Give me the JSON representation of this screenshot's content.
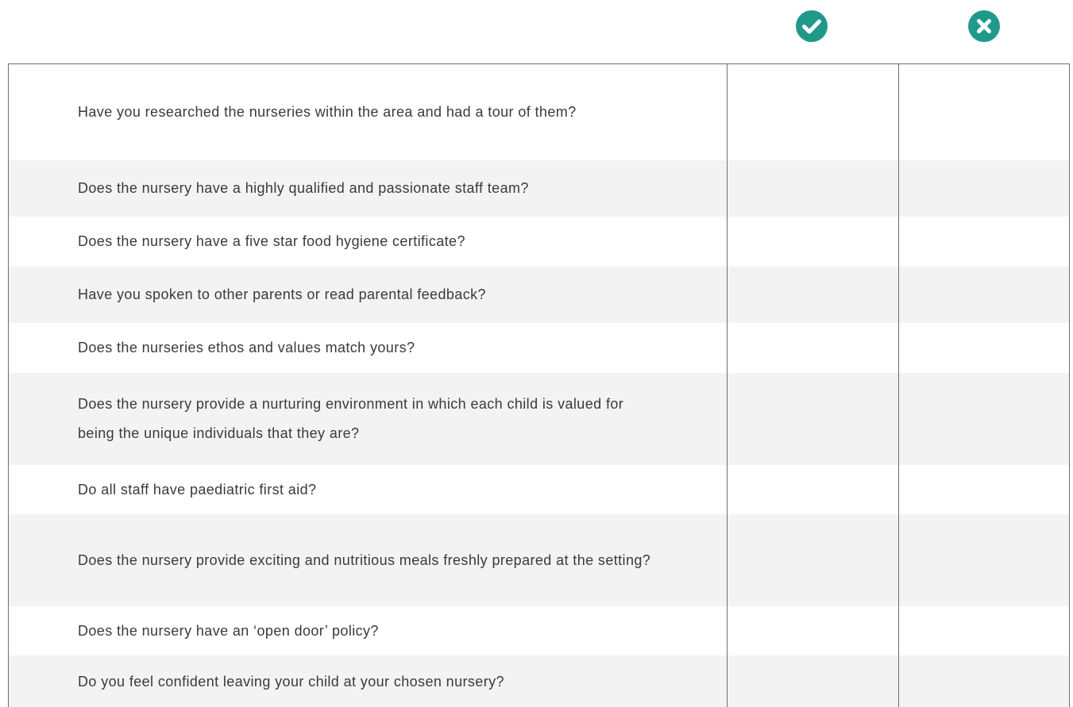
{
  "header": {
    "yes_icon": "check-circle-icon",
    "no_icon": "cross-circle-icon",
    "accent_color": "#1f9a8a"
  },
  "checklist": {
    "rows": [
      {
        "question": "Have you researched the nurseries within the area and had a tour of them?",
        "shaded": false
      },
      {
        "question": "Does the nursery have a highly qualified and passionate staff team?",
        "shaded": true
      },
      {
        "question": "Does the nursery have a five star food hygiene certificate?",
        "shaded": false
      },
      {
        "question": "Have you spoken to other parents or read parental feedback?",
        "shaded": true
      },
      {
        "question": "Does the nurseries ethos and values match yours?",
        "shaded": false
      },
      {
        "question": "Does the nursery provide a nurturing environment in which each child is valued for being the unique individuals that they are?",
        "shaded": true
      },
      {
        "question": "Do all staff have paediatric first aid?",
        "shaded": false
      },
      {
        "question": "Does the nursery provide exciting and nutritious meals freshly prepared at the setting?",
        "shaded": true
      },
      {
        "question": "Does the nursery have an ‘open door’ policy?",
        "shaded": false
      },
      {
        "question": "Do you feel confident leaving your child at your chosen nursery?",
        "shaded": true
      }
    ]
  }
}
